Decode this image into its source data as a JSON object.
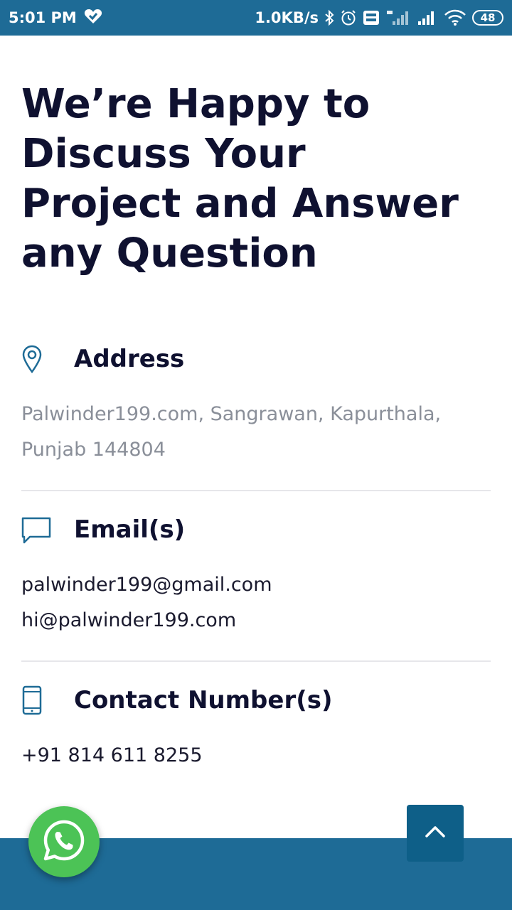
{
  "status_bar": {
    "time": "5:01 PM",
    "net_speed": "1.0KB/s",
    "battery": "48"
  },
  "heading": "We’re Happy to Discuss Your Project and Answer any Question",
  "address": {
    "title": "Address",
    "lines": [
      "Palwinder199.com, Sangrawan, Kapurthala,",
      "Punjab 144804"
    ]
  },
  "email": {
    "title": "Email(s)",
    "lines": [
      "palwinder199@gmail.com",
      "hi@palwinder199.com"
    ]
  },
  "contact": {
    "title": "Contact Number(s)",
    "lines": [
      "+91 814 611 8255"
    ]
  },
  "colors": {
    "brand": "#1e6b96",
    "whatsapp": "#4cc356",
    "scroll_top": "#0e5f88"
  },
  "icons": {
    "address": "map-pin-icon",
    "email": "chat-bubble-icon",
    "contact": "mobile-phone-icon",
    "whatsapp": "whatsapp-icon",
    "scroll_top": "chevron-up-icon"
  }
}
